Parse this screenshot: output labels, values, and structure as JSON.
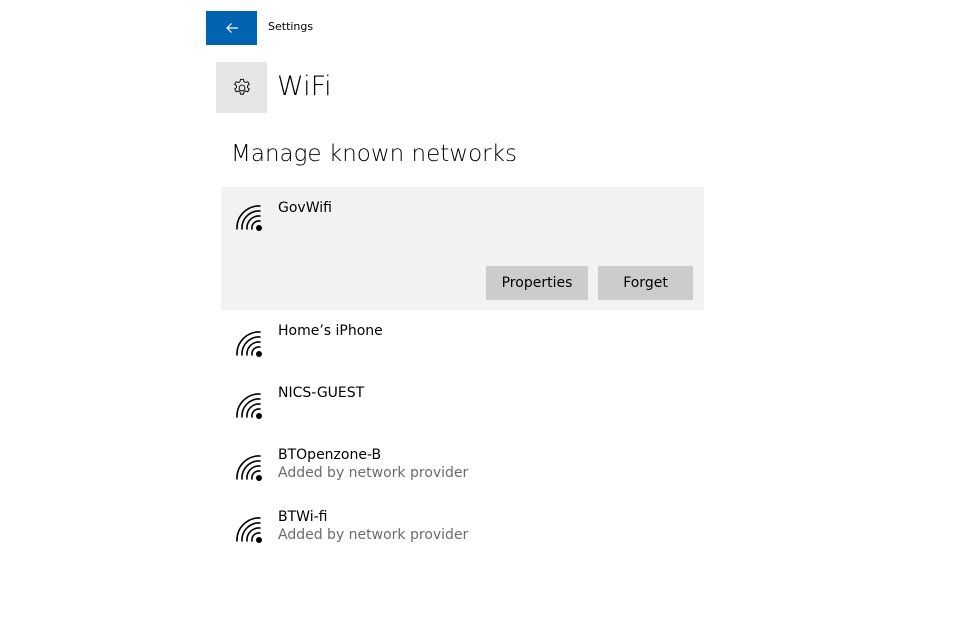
{
  "header": {
    "back_icon": "back-arrow-icon",
    "app_title": "Settings"
  },
  "page": {
    "icon": "gear-icon",
    "title": "WiFi"
  },
  "section": {
    "title": "Manage known networks"
  },
  "networks": [
    {
      "name": "GovWifi",
      "subtitle": "",
      "selected": true,
      "actions": {
        "properties_label": "Properties",
        "forget_label": "Forget"
      }
    },
    {
      "name": "Home’s iPhone",
      "subtitle": ""
    },
    {
      "name": "NICS-GUEST",
      "subtitle": ""
    },
    {
      "name": "BTOpenzone-B",
      "subtitle": "Added by network provider"
    },
    {
      "name": "BTWi-fi",
      "subtitle": "Added by network provider"
    }
  ],
  "colors": {
    "accent": "#0063b1",
    "selected_background": "#f2f2f2",
    "button_background": "#cccccc",
    "secondary_text": "#6b6b6b"
  }
}
